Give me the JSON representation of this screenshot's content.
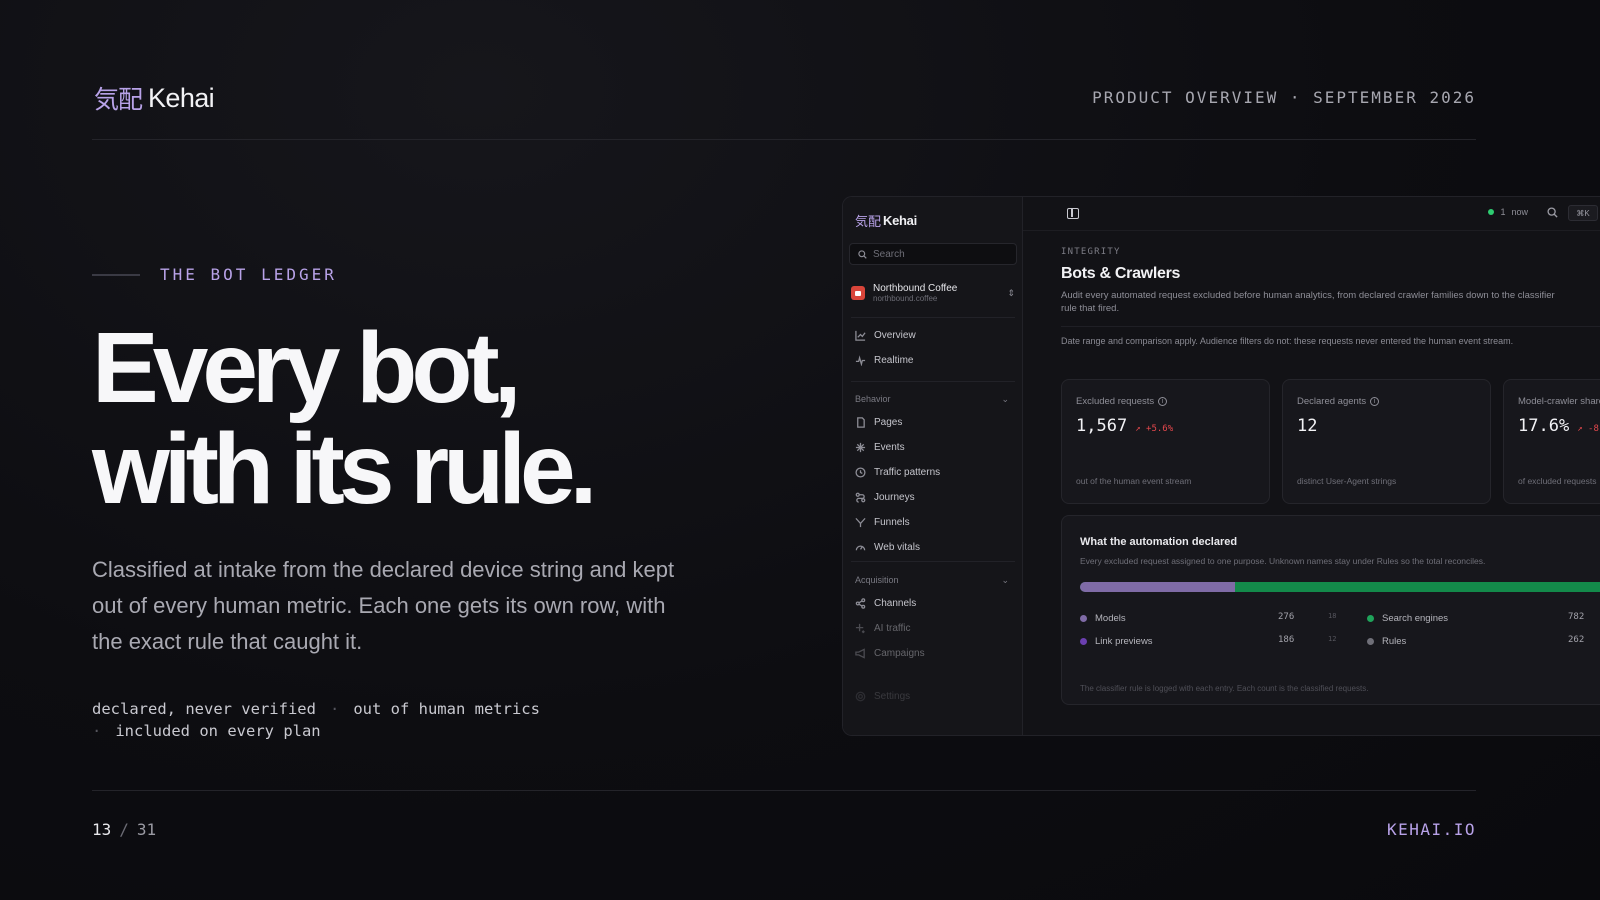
{
  "header": {
    "brand_kanji": "気配",
    "brand_name": "Kehai",
    "meta": "PRODUCT OVERVIEW · SEPTEMBER 2026"
  },
  "hero": {
    "eyebrow": "THE BOT LEDGER",
    "headline_line1": "Every bot,",
    "headline_line2": "with its rule.",
    "lede": "Classified at intake from the declared device string and kept out of every human metric. Each one gets its own row, with the exact rule that caught it.",
    "tags": [
      "declared, never verified",
      "out of human metrics",
      "included on every plan"
    ],
    "tag_separator": "·"
  },
  "footer": {
    "page_current": "13",
    "page_separator": "/",
    "page_total": "31",
    "site": "KEHAI.IO"
  },
  "app": {
    "sidebar": {
      "brand_kanji": "気配",
      "brand_name": "Kehai",
      "search_placeholder": "Search",
      "workspace_name": "Northbound Coffee",
      "workspace_domain": "northbound.coffee",
      "primary": [
        {
          "label": "Overview",
          "icon": "chart-line-icon"
        },
        {
          "label": "Realtime",
          "icon": "pulse-icon"
        }
      ],
      "behavior_label": "Behavior",
      "behavior": [
        {
          "label": "Pages",
          "icon": "file-icon"
        },
        {
          "label": "Events",
          "icon": "sparkle-icon"
        },
        {
          "label": "Traffic patterns",
          "icon": "clock-icon"
        },
        {
          "label": "Journeys",
          "icon": "route-icon"
        },
        {
          "label": "Funnels",
          "icon": "funnel-icon"
        },
        {
          "label": "Web vitals",
          "icon": "gauge-icon"
        }
      ],
      "acquisition_label": "Acquisition",
      "acquisition": [
        {
          "label": "Channels",
          "icon": "share-icon"
        },
        {
          "label": "AI traffic",
          "icon": "sparkles-icon"
        },
        {
          "label": "Campaigns",
          "icon": "megaphone-icon"
        }
      ],
      "settings_label": "Settings"
    },
    "topbar": {
      "live_count": "1",
      "live_label": "now",
      "kbd": "⌘K"
    },
    "main": {
      "crumb": "INTEGRITY",
      "title": "Bots & Crawlers",
      "desc": "Audit every automated request excluded before human analytics, from declared crawler families down to the classifier",
      "desc2": "rule that fired.",
      "note": "Date range and comparison apply. Audience filters do not: these requests never entered the human event stream.",
      "cards": [
        {
          "label": "Excluded requests",
          "value": "1,567",
          "delta": "↗ +5.6%",
          "foot": "out of the human event stream"
        },
        {
          "label": "Declared agents",
          "value": "12",
          "delta": "",
          "foot": "distinct User-Agent strings"
        },
        {
          "label": "Model-crawler share",
          "value": "17.6%",
          "delta": "↗ -8",
          "foot": "of excluded requests"
        }
      ],
      "panel": {
        "title": "What the automation declared",
        "desc": "Every excluded request assigned to one purpose. Unknown names stay under Rules so the total reconciles.",
        "share_models": 0.276,
        "legend": [
          {
            "label": "Models",
            "value": "276",
            "pct": "18",
            "color": "#7f6ba6"
          },
          {
            "label": "Link previews",
            "value": "186",
            "pct": "12",
            "color": "#6b3fb0"
          },
          {
            "label": "Search engines",
            "value": "782",
            "pct": "",
            "color": "#1fa35a"
          },
          {
            "label": "Rules",
            "value": "262",
            "pct": "",
            "color": "#6f6f78"
          }
        ],
        "foot": "The classifier rule is logged with each entry. Each count is the classified requests."
      }
    }
  }
}
